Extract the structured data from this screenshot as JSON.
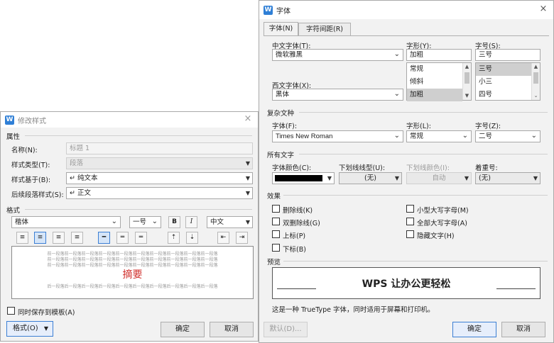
{
  "modify_style": {
    "title": "修改样式",
    "close": "×",
    "props_section": "属性",
    "name_label": "名称(N):",
    "name_value": "标题 1",
    "type_label": "样式类型(T):",
    "type_value": "段落",
    "based_label": "样式基于(B):",
    "based_value": "↵ 纯文本",
    "next_label": "后续段落样式(S):",
    "next_value": "↵ 正文",
    "format_section": "格式",
    "font_value": "楷体",
    "size_value": "一号",
    "bold": "B",
    "italic": "I",
    "lang_value": "中文",
    "preview_lines_before": "前一段落前一段落前一段落前一段落前一段落前一段落前一段落前一段落前一段落前一段落",
    "preview_heading": "摘要",
    "preview_lines_after": "后一段落后一段落后一段落后一段落后一段落后一段落后一段落后一段落后一段落后一段落",
    "save_template_label": "同时保存到模板(A)",
    "format_button": "格式(O)",
    "ok_button": "确定",
    "cancel_button": "取消"
  },
  "font_dialog": {
    "title": "字体",
    "close": "×",
    "tabs": [
      "字体(N)",
      "字符间距(R)"
    ],
    "cn_font_label": "中文字体(T):",
    "cn_font_value": "微软雅黑",
    "style_label": "字形(Y):",
    "style_value": "加粗",
    "style_options": [
      "常规",
      "倾斜",
      "加粗"
    ],
    "size_label": "字号(S):",
    "size_value": "三号",
    "size_options": [
      "三号",
      "小三",
      "四号"
    ],
    "west_font_label": "西文字体(X):",
    "west_font_value": "黑体",
    "complex_section": "复杂文种",
    "cx_font_label": "字体(F):",
    "cx_font_value": "Times New Roman",
    "cx_style_label": "字形(L):",
    "cx_style_value": "常规",
    "cx_size_label": "字号(Z):",
    "cx_size_value": "二号",
    "all_text_section": "所有文字",
    "color_label": "字体颜色(C):",
    "color_value": "#000000",
    "underline_label": "下划线线型(U):",
    "underline_value": "(无)",
    "underline_color_label": "下划线颜色(I):",
    "underline_color_value": "自动",
    "emphasis_label": "着重号:",
    "emphasis_value": "(无)",
    "effects_section": "效果",
    "effects": [
      "删除线(K)",
      "双删除线(G)",
      "上标(P)",
      "下标(B)",
      "小型大写字母(M)",
      "全部大写字母(A)",
      "隐藏文字(H)"
    ],
    "preview_section": "预览",
    "preview_text": "WPS 让办公更轻松",
    "note": "这是一种 TrueType 字体，同时适用于屏幕和打印机。",
    "default_button": "默认(D)...",
    "ok_button": "确定",
    "cancel_button": "取消"
  },
  "colors": {
    "accent": "#2f7fd6",
    "preview_heading": "#d0312d"
  }
}
